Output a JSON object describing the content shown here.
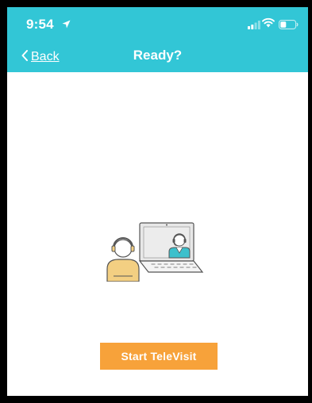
{
  "status_bar": {
    "time": "9:54",
    "icons": [
      "location-arrow-icon",
      "cellular-signal-icon",
      "wifi-icon",
      "battery-icon"
    ]
  },
  "nav": {
    "back_label": "Back",
    "title": "Ready?"
  },
  "main": {
    "illustration": "televisit-laptop-illustration",
    "start_button_label": "Start TeleVisit"
  },
  "colors": {
    "header": "#32c6d6",
    "button": "#f7a23a",
    "background": "#ffffff",
    "frame": "#000000"
  }
}
